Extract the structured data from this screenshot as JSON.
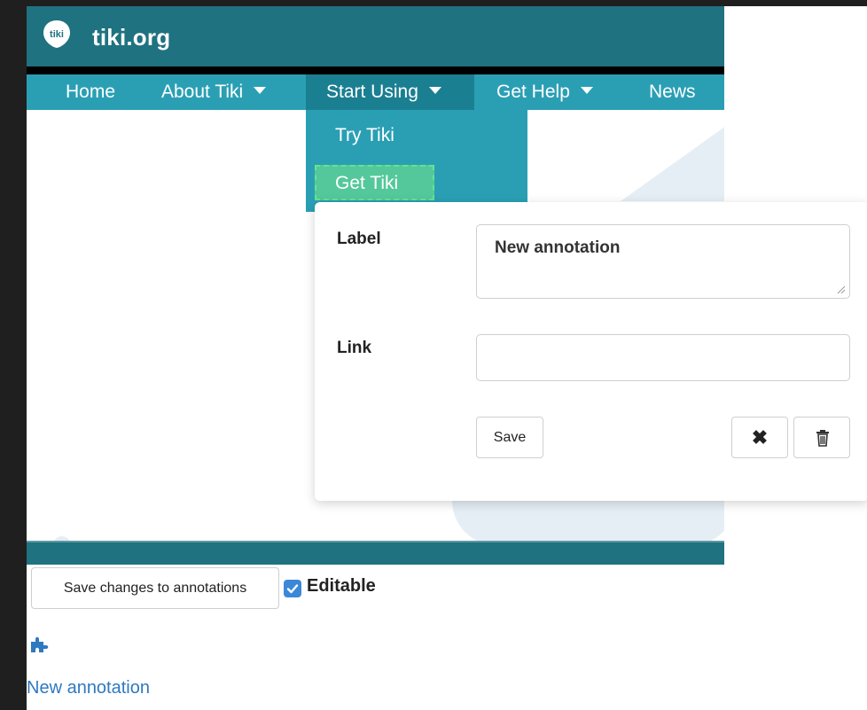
{
  "site": {
    "name": "tiki.org",
    "logo_text": "tiki"
  },
  "nav": {
    "items": [
      {
        "label": "Home",
        "has_caret": false
      },
      {
        "label": "About Tiki",
        "has_caret": true
      },
      {
        "label": "Start Using",
        "has_caret": true,
        "active": true
      },
      {
        "label": "Get Help",
        "has_caret": true
      },
      {
        "label": "News",
        "has_caret": false
      }
    ]
  },
  "dropdown": {
    "items": [
      {
        "label": "Try Tiki"
      },
      {
        "label": "Get Tiki",
        "selected": true
      }
    ]
  },
  "annotation_form": {
    "label_caption": "Label",
    "label_value": "New annotation",
    "link_caption": "Link",
    "link_value": "",
    "save_label": "Save",
    "close_icon": "close-icon",
    "delete_icon": "trash-icon"
  },
  "controls": {
    "save_changes_label": "Save changes to annotations",
    "editable_label": "Editable",
    "editable_checked": true,
    "plugin_icon": "puzzle-icon",
    "new_annotation_link": "New annotation"
  },
  "colors": {
    "header_dark": "#1f7280",
    "nav_teal": "#2a9fb4",
    "selected_green": "#54c89a",
    "link_blue": "#2f79c0",
    "checkbox_blue": "#3d87d9"
  }
}
